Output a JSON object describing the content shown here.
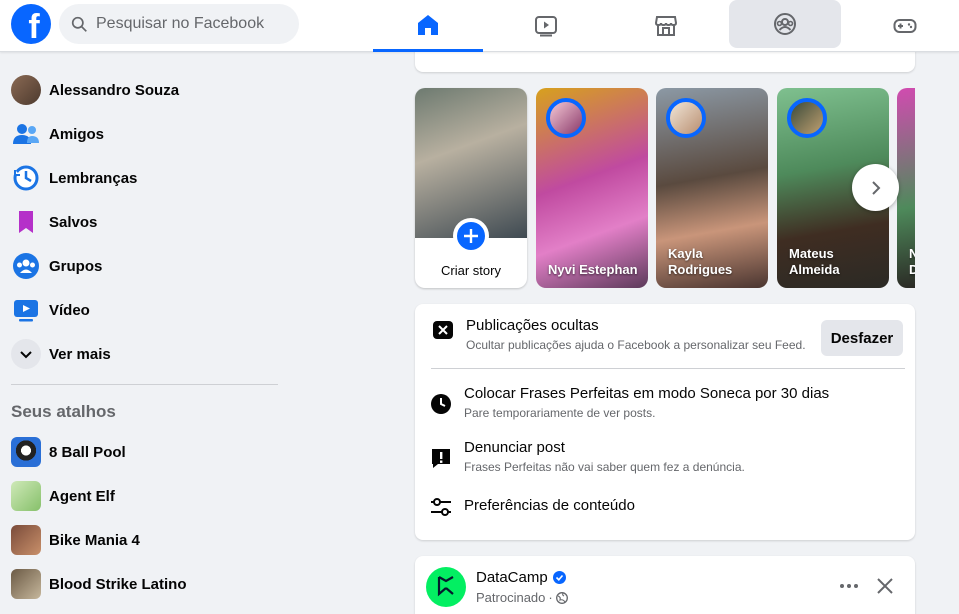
{
  "header": {
    "logo_letter": "f",
    "search_placeholder": "Pesquisar no Facebook",
    "tabs": [
      {
        "icon": "home-icon",
        "active": true
      },
      {
        "icon": "video-icon"
      },
      {
        "icon": "marketplace-icon"
      },
      {
        "icon": "groups-icon"
      },
      {
        "icon": "gaming-icon"
      }
    ]
  },
  "sidebar": {
    "items": [
      {
        "label": "Alessandro Souza",
        "icon": "avatar"
      },
      {
        "label": "Amigos",
        "icon": "friends-icon"
      },
      {
        "label": "Lembranças",
        "icon": "memories-icon"
      },
      {
        "label": "Salvos",
        "icon": "saved-icon"
      },
      {
        "label": "Grupos",
        "icon": "groups-icon"
      },
      {
        "label": "Vídeo",
        "icon": "video-icon"
      },
      {
        "label": "Ver mais",
        "icon": "chevron-down-icon"
      }
    ],
    "shortcuts_title": "Seus atalhos",
    "shortcuts": [
      {
        "label": "8 Ball Pool"
      },
      {
        "label": "Agent Elf"
      },
      {
        "label": "Bike Mania 4"
      },
      {
        "label": "Blood Strike Latino"
      }
    ]
  },
  "stories": {
    "create_label": "Criar story",
    "items": [
      {
        "name": "Nyvi Estephan"
      },
      {
        "name": "Kayla Rodrigues"
      },
      {
        "name": "Mateus Almeida"
      },
      {
        "name": "N D"
      }
    ]
  },
  "hidden_post": {
    "title": "Publicações ocultas",
    "subtitle": "Ocultar publicações ajuda o Facebook a personalizar seu Feed.",
    "undo_label": "Desfazer",
    "options": [
      {
        "title": "Colocar Frases Perfeitas em modo Soneca por 30 dias",
        "subtitle": "Pare temporariamente de ver posts.",
        "icon": "clock-icon"
      },
      {
        "title": "Denunciar post",
        "subtitle": "Frases Perfeitas não vai saber quem fez a denúncia.",
        "icon": "report-icon"
      },
      {
        "title": "Preferências de conteúdo",
        "subtitle": "",
        "icon": "preferences-icon"
      }
    ]
  },
  "sponsored": {
    "page_name": "DataCamp",
    "label": "Patrocinado",
    "separator": "·"
  },
  "colors": {
    "brand": "#0866ff",
    "bg": "#f0f2f5"
  }
}
